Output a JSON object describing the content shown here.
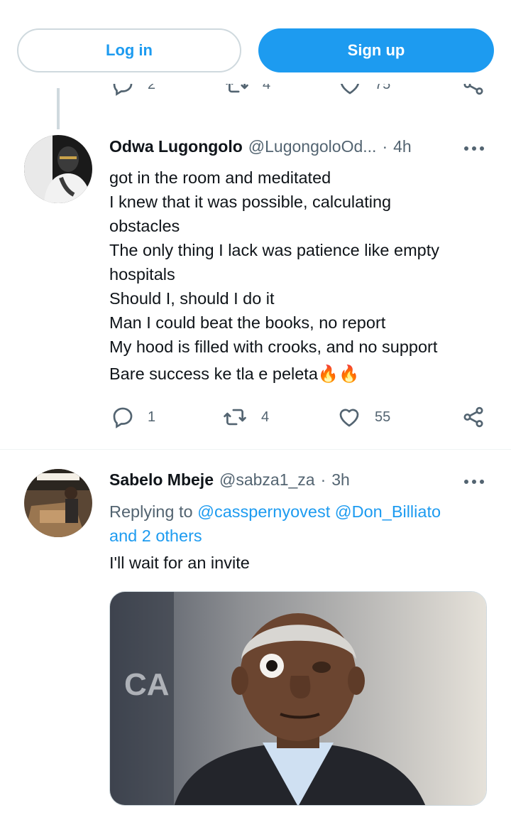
{
  "auth": {
    "login_label": "Log in",
    "signup_label": "Sign up"
  },
  "previous_tweet": {
    "reply_count": "2",
    "retweet_count": "4",
    "like_count": "75"
  },
  "tweets": [
    {
      "display_name": "Odwa Lugongolo",
      "handle": "@LugongoloOd...",
      "separator": "·",
      "time": "4h",
      "lines": [
        "got in the room and meditated",
        "I knew that it was possible, calculating",
        "obstacles",
        "The only thing I lack was patience like empty",
        "hospitals",
        "Should I, should I do it",
        "Man I could beat the books, no report",
        "My hood is filled with crooks, and no support",
        "Bare success ke tla e peleta🔥🔥"
      ],
      "reply_count": "1",
      "retweet_count": "4",
      "like_count": "55"
    },
    {
      "display_name": "Sabelo Mbeje",
      "handle": "@sabza1_za",
      "separator": "·",
      "time": "3h",
      "replying_prefix": "Replying to",
      "mention_1": "@casspernyovest",
      "mention_2": "@Don_Billiato",
      "and_others": "and 2 others",
      "text": "I'll wait for an invite",
      "media_text": "CA"
    }
  ],
  "colors": {
    "accent": "#1d9bf0",
    "secondary_text": "#536471",
    "border": "#cfd9de"
  }
}
